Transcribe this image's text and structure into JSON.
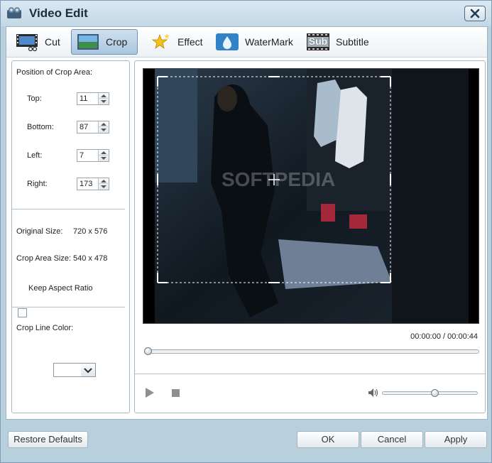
{
  "window": {
    "title": "Video Edit"
  },
  "tabs": [
    {
      "label": "Cut",
      "icon": "film-scissors-icon"
    },
    {
      "label": "Crop",
      "icon": "crop-picture-icon",
      "active": true
    },
    {
      "label": "Effect",
      "icon": "stars-icon"
    },
    {
      "label": "WaterMark",
      "icon": "water-drop-icon"
    },
    {
      "label": "Subtitle",
      "icon": "subtitle-film-icon",
      "icon_text": "Sub"
    }
  ],
  "crop": {
    "position_heading": "Position of Crop Area:",
    "top_label": "Top:",
    "top_value": "11",
    "bottom_label": "Bottom:",
    "bottom_value": "87",
    "left_label": "Left:",
    "left_value": "7",
    "right_label": "Right:",
    "right_value": "173",
    "original_size_label": "Original Size:",
    "original_size_value": "720 x 576",
    "crop_area_size_label": "Crop Area Size:",
    "crop_area_size_value": "540 x 478",
    "keep_aspect_label": "Keep Aspect Ratio",
    "keep_aspect_checked": false,
    "crop_line_color_label": "Crop Line Color:",
    "crop_line_color": "#ffffff"
  },
  "preview": {
    "watermark_text": "SOFTPEDIA",
    "current_time": "00:00:00",
    "separator": "/",
    "total_time": "00:00:44",
    "seek_position": 0.0,
    "volume_level": 0.5
  },
  "buttons": {
    "restore_defaults": "Restore Defaults",
    "ok": "OK",
    "cancel": "Cancel",
    "apply": "Apply"
  },
  "colors": {
    "window_bg": "#b8d0dc",
    "active_tab": "#a9c6e0"
  }
}
